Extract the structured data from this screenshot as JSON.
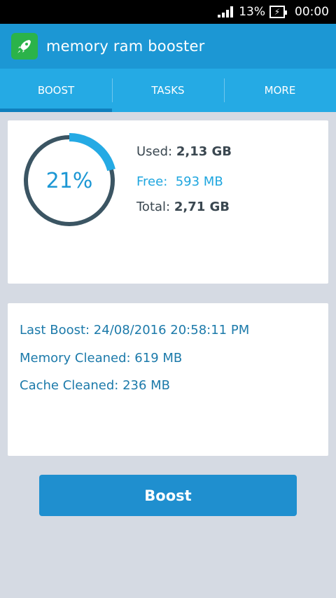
{
  "status_bar": {
    "battery_percent": "13%",
    "time": "00:00"
  },
  "app_bar": {
    "title": "memory ram booster",
    "icon": "rocket-icon"
  },
  "tabs": [
    {
      "label": "BOOST",
      "active": true
    },
    {
      "label": "TASKS",
      "active": false
    },
    {
      "label": "MORE",
      "active": false
    }
  ],
  "memory": {
    "percent_label": "21%",
    "percent": 21,
    "used_label": "Used:",
    "used_value": "2,13 GB",
    "free_label": "Free:",
    "free_value": "593 MB",
    "total_label": "Total:",
    "total_value": "2,71 GB"
  },
  "stats": {
    "last_boost": "Last Boost: 24/08/2016 20:58:11 PM",
    "memory_cleaned": "Memory Cleaned: 619 MB",
    "cache_cleaned": "Cache Cleaned: 236 MB"
  },
  "boost_button": {
    "label": "Boost"
  },
  "colors": {
    "primary": "#1c97d4",
    "tab_bar": "#25aae4",
    "gauge_track": "#3b5563",
    "gauge_fill": "#25aae4",
    "app_icon": "#2bb34a"
  }
}
